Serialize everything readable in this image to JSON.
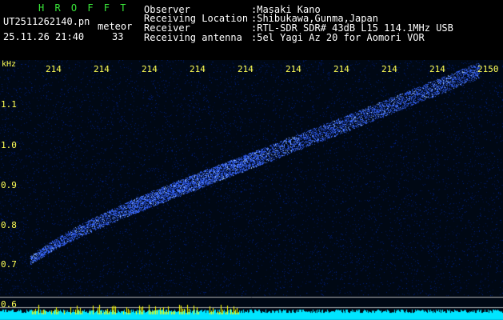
{
  "header": {
    "program": "H R O F F T",
    "filename": "UT2511262140.pn",
    "mode": "meteor",
    "datetime": "25.11.26 21:40",
    "count": "33",
    "fields": [
      {
        "label": "Observer",
        "value": ":Masaki Kano"
      },
      {
        "label": "Receiving Location",
        "value": ":Shibukawa,Gunma,Japan"
      },
      {
        "label": "Receiver",
        "value": ":RTL-SDR SDR# 43dB L15 114.1MHz USB"
      },
      {
        "label": "Receiving antenna",
        "value": ":5el Yagi Az 20 for Aomori VOR"
      }
    ]
  },
  "plot": {
    "y_unit": "kHz",
    "y_ticks": [
      "1.1",
      "1.0",
      "0.9",
      "0.8",
      "0.7",
      "0.6"
    ],
    "time_labels": [
      "214",
      "214",
      "214",
      "214",
      "214",
      "214",
      "214",
      "214",
      "214",
      "2150"
    ],
    "colors": {
      "background": "#000814",
      "trace": "#3a6bff",
      "baseline": "#00e5ff",
      "hot": "#ffff00"
    }
  }
}
